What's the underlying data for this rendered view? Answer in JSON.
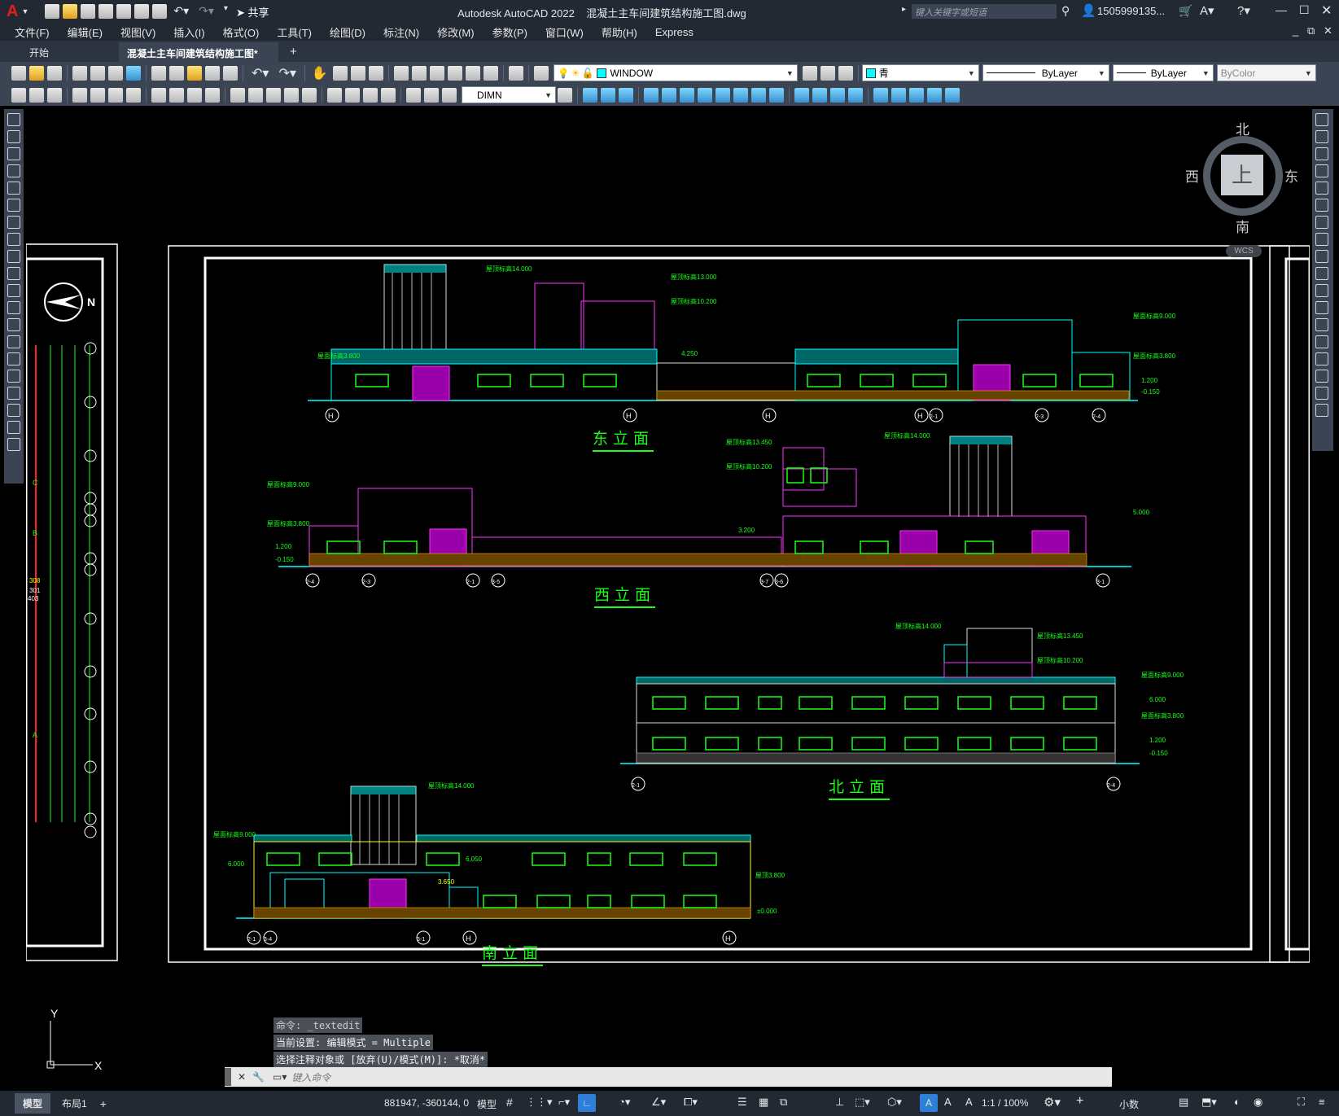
{
  "title": {
    "app_name": "Autodesk AutoCAD 2022",
    "file_name": "混凝土主车间建筑结构施工图.dwg",
    "share_label": "共享",
    "search_placeholder": "键入关键字或短语",
    "user": "1505999135..."
  },
  "menu": [
    "文件(F)",
    "编辑(E)",
    "视图(V)",
    "插入(I)",
    "格式(O)",
    "工具(T)",
    "绘图(D)",
    "标注(N)",
    "修改(M)",
    "参数(P)",
    "窗口(W)",
    "帮助(H)",
    "Express"
  ],
  "tabs": {
    "start": "开始",
    "active": "混凝土主车间建筑结构施工图*"
  },
  "toolbar": {
    "layer": "WINDOW",
    "color": "青",
    "linetype": "ByLayer",
    "lineweight": "ByLayer",
    "plotstyle": "ByColor",
    "dimstyle": "DIMN"
  },
  "viewcube": {
    "north": "北",
    "south": "南",
    "east": "东",
    "west": "西",
    "top": "上",
    "wcs": "WCS"
  },
  "drawing": {
    "east_title": "东立面",
    "west_title": "西立面",
    "north_title": "北立面",
    "south_title": "南立面",
    "north_arrow": "N",
    "east_levels": [
      "屋顶标高14.000",
      "屋顶标高13.000",
      "屋顶标高10.200",
      "4.250",
      "屋面标高3.800",
      "屋面标高9.000",
      "屋面标高3.800",
      "1.200",
      "-0.150"
    ],
    "east_axes": [
      "H",
      "H",
      "H",
      "H",
      "2-1",
      "2-3",
      "2-4"
    ],
    "west_levels": [
      "屋面标高9.000",
      "屋面标高3.800",
      "1.200",
      "-0.150",
      "3.200",
      "屋顶标高13.450",
      "屋顶标高10.200",
      "屋顶标高14.000",
      "5.000"
    ],
    "west_axes": [
      "2-4",
      "2-3",
      "2-1",
      "3-5",
      "3-7",
      "3-6",
      "3-1"
    ],
    "north_levels": [
      "屋顶标高14.000",
      "屋顶标高13.450",
      "屋顶标高10.200",
      "屋面标高9.000",
      "6.000",
      "屋面标高3.800",
      "1.200",
      "-0.150"
    ],
    "north_axes": [
      "2-1",
      "2-4"
    ],
    "south_levels": [
      "屋顶标高14.000",
      "屋面标高9.000",
      "6.000",
      "6.050",
      "3.650",
      "屋顶3.800",
      "±0.000"
    ],
    "south_axes": [
      "2-1",
      "3-4",
      "3-1",
      "H",
      "H"
    ],
    "side_labels": [
      "C",
      "B",
      "A",
      "308",
      "301",
      "403"
    ]
  },
  "command": {
    "history": [
      "命令: _textedit",
      "当前设置: 编辑模式 = Multiple",
      "选择注释对象或 [放弃(U)/模式(M)]: *取消*"
    ],
    "placeholder": "键入命令"
  },
  "status": {
    "model_tab": "模型",
    "layout_tab": "布局1",
    "coords": "881947, -360144, 0",
    "space": "模型",
    "scale": "1:1 / 100%",
    "units": "小数"
  }
}
